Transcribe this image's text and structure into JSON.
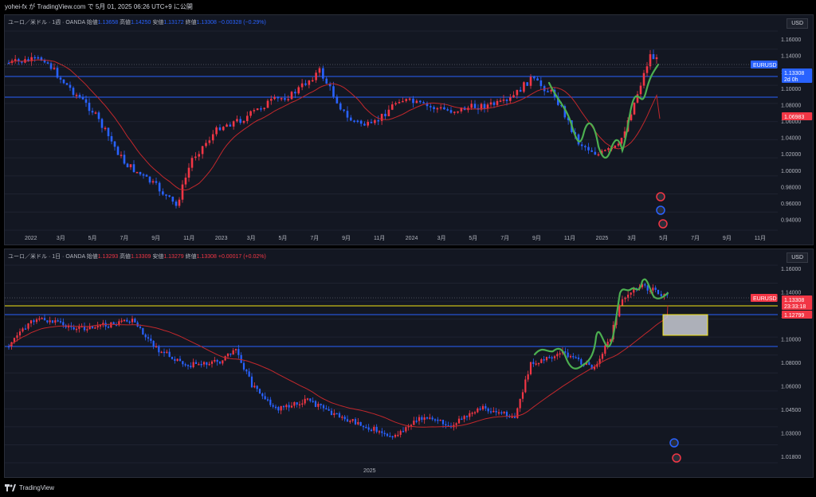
{
  "header": {
    "text": "yohei-fx が TradingView.com で 5月 01, 2025 06:26 UTC+9 に公開"
  },
  "footer": {
    "brand": "TradingView"
  },
  "colors": {
    "up": "#f23645",
    "down": "#2962ff",
    "ma": "#c2282c",
    "wave": "#4caf50",
    "hline": "#2962ff",
    "yellow": "#f5e614",
    "bg": "#131722"
  },
  "panes": [
    {
      "currency": "USD",
      "legend": {
        "title": "ユーロ／米ドル · 1週 · OANDA",
        "o_label": "始値",
        "o": "1.13658",
        "h_label": "高値",
        "h": "1.14250",
        "l_label": "安値",
        "l": "1.13172",
        "c_label": "終値",
        "c": "1.13308",
        "chg": "−0.00328 (−0.29%)"
      },
      "price_axis": [
        "1.16000",
        "1.14000",
        "1.12000",
        "1.10000",
        "1.08000",
        "1.06000",
        "1.04000",
        "1.02000",
        "1.00000",
        "0.98000",
        "0.96000",
        "0.94000"
      ],
      "time_axis": [
        "2022",
        "3月",
        "5月",
        "7月",
        "9月",
        "11月",
        "2023",
        "3月",
        "5月",
        "7月",
        "9月",
        "11月",
        "2024",
        "3月",
        "5月",
        "7月",
        "9月",
        "11月",
        "2025",
        "3月",
        "5月",
        "7月",
        "9月",
        "11月"
      ],
      "tags": [
        {
          "text": "EURUSD",
          "sub": "",
          "color": "#2962ff"
        },
        {
          "text": "1.13308",
          "sub": "2d 0h",
          "color": "#2962ff"
        },
        {
          "text": "1.06983",
          "sub": "",
          "color": "#f23645"
        }
      ]
    },
    {
      "currency": "USD",
      "legend": {
        "title": "ユーロ／米ドル · 1日 · OANDA",
        "o_label": "始値",
        "o": "1.13293",
        "h_label": "高値",
        "h": "1.13309",
        "l_label": "安値",
        "l": "1.13279",
        "c_label": "終値",
        "c": "1.13308",
        "chg": "+0.00017 (+0.02%)"
      },
      "price_axis": [
        "1.16000",
        "1.14000",
        "1.12000",
        "1.10000",
        "1.08000",
        "1.06000",
        "1.04500",
        "1.03000",
        "1.01800",
        "1.00600"
      ],
      "time_axis": [
        "2025"
      ],
      "tags": [
        {
          "text": "EURUSD",
          "sub": "",
          "color": "#f23645"
        },
        {
          "text": "1.13308",
          "sub": "23:33:18",
          "color": "#f23645"
        },
        {
          "text": "1.12799",
          "sub": "",
          "color": "#f23645"
        }
      ]
    }
  ]
}
